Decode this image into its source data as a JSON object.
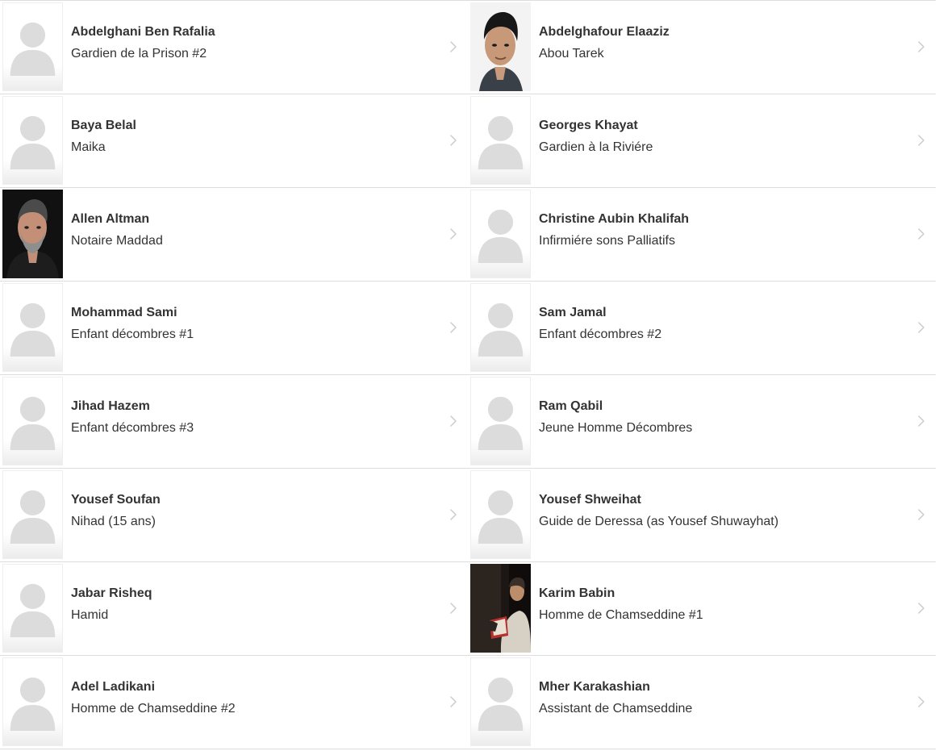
{
  "cast": [
    {
      "actor": "Abdelghani Ben Rafalia",
      "character": "Gardien de la Prison #2",
      "photo": "placeholder"
    },
    {
      "actor": "Abdelghafour Elaaziz",
      "character": "Abou Tarek",
      "photo": "headshot-dark-hair-man"
    },
    {
      "actor": "Baya Belal",
      "character": "Maika",
      "photo": "placeholder"
    },
    {
      "actor": "Georges Khayat",
      "character": "Gardien à la Riviére",
      "photo": "placeholder"
    },
    {
      "actor": "Allen Altman",
      "character": "Notaire Maddad",
      "photo": "headshot-bearded-man"
    },
    {
      "actor": "Christine Aubin Khalifah",
      "character": "Infirmiére sons Palliatifs",
      "photo": "placeholder"
    },
    {
      "actor": "Mohammad Sami",
      "character": "Enfant décombres #1",
      "photo": "placeholder"
    },
    {
      "actor": "Sam Jamal",
      "character": "Enfant décombres #2",
      "photo": "placeholder"
    },
    {
      "actor": "Jihad Hazem",
      "character": "Enfant décombres #3",
      "photo": "placeholder"
    },
    {
      "actor": "Ram Qabil",
      "character": "Jeune Homme Décombres",
      "photo": "placeholder"
    },
    {
      "actor": "Yousef Soufan",
      "character": "Nihad (15 ans)",
      "photo": "placeholder"
    },
    {
      "actor": "Yousef Shweihat",
      "character": "Guide de Deressa (as Yousef Shuwayhat)",
      "photo": "placeholder"
    },
    {
      "actor": "Jabar Risheq",
      "character": "Hamid",
      "photo": "placeholder"
    },
    {
      "actor": "Karim Babin",
      "character": "Homme de Chamseddine #1",
      "photo": "film-still-man-reading"
    },
    {
      "actor": "Adel Ladikani",
      "character": "Homme de Chamseddine #2",
      "photo": "placeholder"
    },
    {
      "actor": "Mher Karakashian",
      "character": "Assistant de Chamseddine",
      "photo": "placeholder"
    }
  ],
  "icons": {
    "placeholder": "person-silhouette-icon",
    "row_arrow": "chevron-right-icon"
  },
  "colors": {
    "text": "#333333",
    "divider": "#dddddd",
    "placeholder_silhouette": "#dcdcdc",
    "chevron": "#cccccc"
  }
}
